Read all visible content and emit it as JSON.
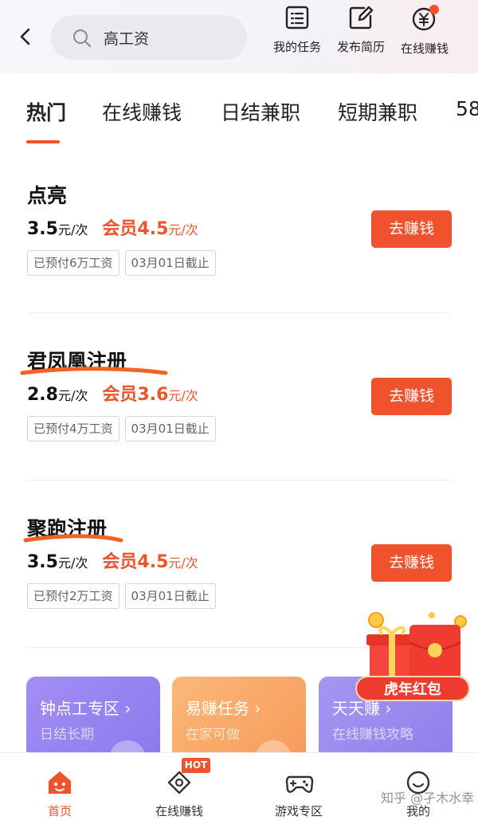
{
  "header": {
    "search": {
      "value": "高工资"
    },
    "tools": [
      {
        "label": "我的任务",
        "icon": "task-list-icon"
      },
      {
        "label": "发布简历",
        "icon": "edit-icon"
      },
      {
        "label": "在线赚钱",
        "icon": "yuan-coin-icon"
      }
    ]
  },
  "tabs": [
    "热门",
    "在线赚钱",
    "日结兼职",
    "短期兼职",
    "58"
  ],
  "active_tab": "热门",
  "jobs": [
    {
      "title": "点亮",
      "price": "3.5",
      "price_unit": "元/次",
      "vip_label": "会员",
      "vip_price": "4.5",
      "vip_unit": "元/次",
      "tags": [
        "已预付6万工资",
        "03月01日截止"
      ],
      "button": "去赚钱"
    },
    {
      "title": "君凤凰注册",
      "price": "2.8",
      "price_unit": "元/次",
      "vip_label": "会员",
      "vip_price": "3.6",
      "vip_unit": "元/次",
      "tags": [
        "已预付4万工资",
        "03月01日截止"
      ],
      "button": "去赚钱"
    },
    {
      "title": "聚跑注册",
      "price": "3.5",
      "price_unit": "元/次",
      "vip_label": "会员",
      "vip_price": "4.5",
      "vip_unit": "元/次",
      "tags": [
        "已预付2万工资",
        "03月01日截止"
      ],
      "button": "去赚钱"
    }
  ],
  "cards": [
    {
      "title": "钟点工专区 ›",
      "subtitle": "日结长期",
      "color": "#9b86f2"
    },
    {
      "title": "易赚任务 ›",
      "subtitle": "在家可做",
      "color": "#f9ad6a"
    },
    {
      "title": "天天赚 ›",
      "subtitle": "在线赚钱攻略",
      "color": "#9c8cf0"
    }
  ],
  "redpack": {
    "label": "虎年红包"
  },
  "bottom_nav": [
    {
      "label": "首页",
      "icon": "home-icon",
      "active": true
    },
    {
      "label": "在线赚钱",
      "icon": "money-tag-icon",
      "active": false,
      "badge": "HOT"
    },
    {
      "label": "游戏专区",
      "icon": "gamepad-icon",
      "active": false
    },
    {
      "label": "我的",
      "icon": "smile-face-icon",
      "active": false
    }
  ],
  "watermark": "知乎 @孑木水幸",
  "colors": {
    "accent": "#f0522d",
    "vip": "#e9552c",
    "annotation": "#f26322"
  }
}
